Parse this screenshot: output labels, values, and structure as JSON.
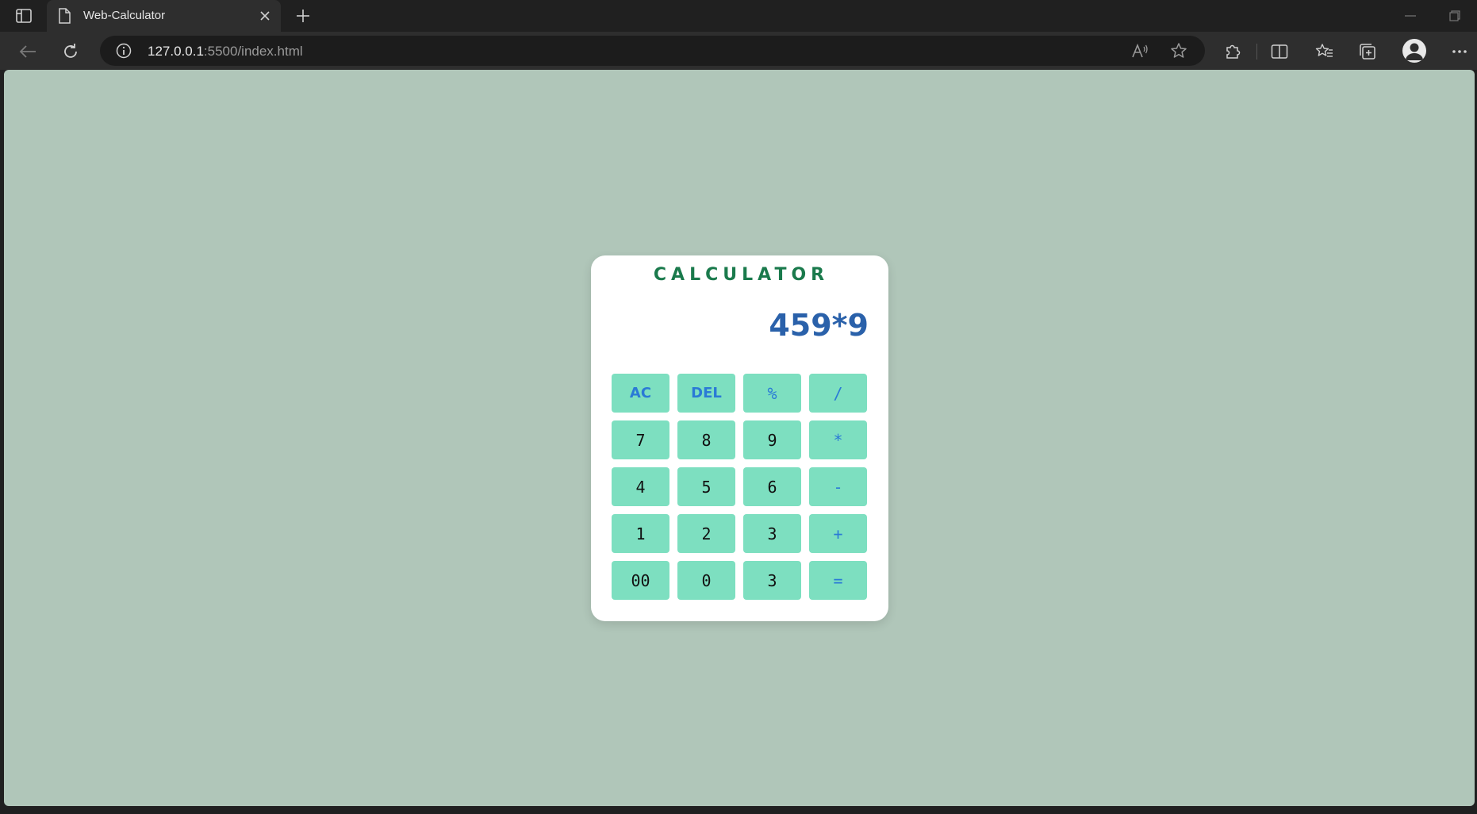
{
  "browser": {
    "tab_title": "Web-Calculator",
    "url_host": "127.0.0.1",
    "url_rest": ":5500/index.html"
  },
  "calculator": {
    "title": "CALCULATOR",
    "display": "459*9",
    "keys": [
      {
        "label": "AC",
        "kind": "fn"
      },
      {
        "label": "DEL",
        "kind": "fn"
      },
      {
        "label": "%",
        "kind": "op"
      },
      {
        "label": "/",
        "kind": "op"
      },
      {
        "label": "7",
        "kind": "num"
      },
      {
        "label": "8",
        "kind": "num"
      },
      {
        "label": "9",
        "kind": "num"
      },
      {
        "label": "*",
        "kind": "op"
      },
      {
        "label": "4",
        "kind": "num"
      },
      {
        "label": "5",
        "kind": "num"
      },
      {
        "label": "6",
        "kind": "num"
      },
      {
        "label": "-",
        "kind": "op"
      },
      {
        "label": "1",
        "kind": "num"
      },
      {
        "label": "2",
        "kind": "num"
      },
      {
        "label": "3",
        "kind": "num"
      },
      {
        "label": "+",
        "kind": "op"
      },
      {
        "label": "00",
        "kind": "num"
      },
      {
        "label": "0",
        "kind": "num"
      },
      {
        "label": "3",
        "kind": "num"
      },
      {
        "label": "=",
        "kind": "op"
      }
    ]
  },
  "colors": {
    "page_background": "#b0c6b9",
    "key_background": "#7ddfc0",
    "title_color": "#1a7a4c",
    "display_color": "#2a61aa",
    "operator_color": "#2a7ad6"
  }
}
